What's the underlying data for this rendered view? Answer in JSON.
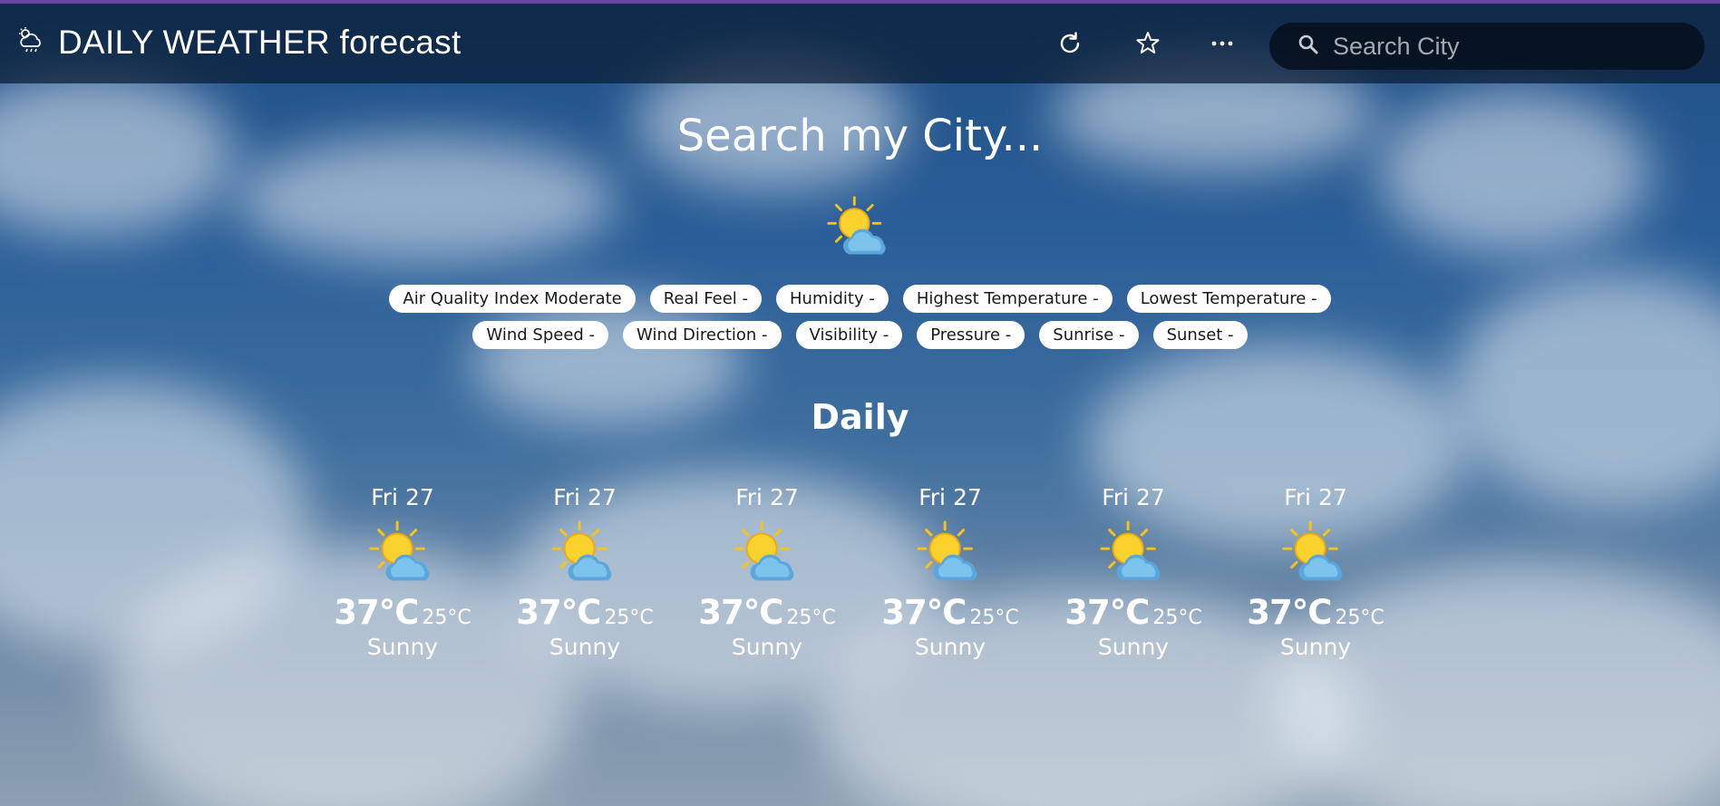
{
  "app": {
    "title": "DAILY WEATHER forecast",
    "accent_color": "#6a42a8",
    "topbar_icons": [
      "weather-cloud-icon",
      "refresh-icon",
      "star-icon",
      "more-icon",
      "search-icon"
    ]
  },
  "search": {
    "placeholder": "Search City",
    "value": ""
  },
  "main": {
    "heading": "Search my City...",
    "current_icon": "sun-behind-cloud-icon",
    "chips_row1": [
      "Air Quality Index Moderate",
      "Real Feel -",
      "Humidity -",
      "Highest Temperature -",
      "Lowest Temperature -"
    ],
    "chips_row2": [
      "Wind Speed -",
      "Wind Direction -",
      "Visibility -",
      "Pressure -",
      "Sunrise -",
      "Sunset -"
    ]
  },
  "daily": {
    "title": "Daily",
    "days": [
      {
        "date": "Fri 27",
        "high": "37°C",
        "low": "25°C",
        "condition": "Sunny",
        "icon": "sun-behind-cloud-icon"
      },
      {
        "date": "Fri 27",
        "high": "37°C",
        "low": "25°C",
        "condition": "Sunny",
        "icon": "sun-behind-cloud-icon"
      },
      {
        "date": "Fri 27",
        "high": "37°C",
        "low": "25°C",
        "condition": "Sunny",
        "icon": "sun-behind-cloud-icon"
      },
      {
        "date": "Fri 27",
        "high": "37°C",
        "low": "25°C",
        "condition": "Sunny",
        "icon": "sun-behind-cloud-icon"
      },
      {
        "date": "Fri 27",
        "high": "37°C",
        "low": "25°C",
        "condition": "Sunny",
        "icon": "sun-behind-cloud-icon"
      },
      {
        "date": "Fri 27",
        "high": "37°C",
        "low": "25°C",
        "condition": "Sunny",
        "icon": "sun-behind-cloud-icon"
      }
    ]
  }
}
